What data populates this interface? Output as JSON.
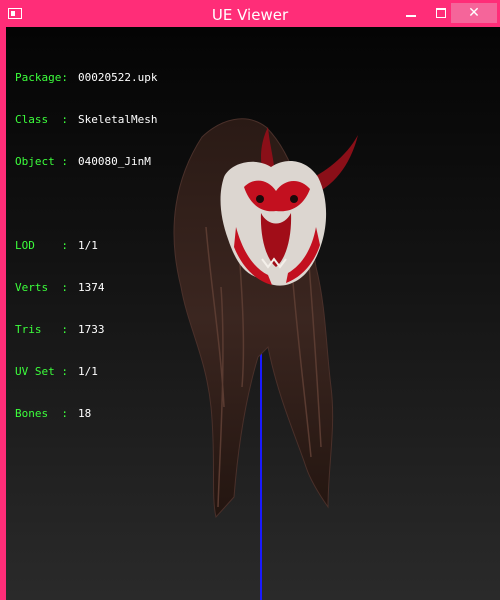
{
  "window": {
    "title": "UE Viewer",
    "close_glyph": "✕"
  },
  "info": {
    "package": {
      "label": "Package:",
      "value": "00020522.upk"
    },
    "class": {
      "label": "Class  :",
      "value": "SkeletalMesh"
    },
    "object": {
      "label": "Object :",
      "value": "040080_JinM"
    },
    "lod": {
      "label": "LOD    :",
      "value": "1/1"
    },
    "verts": {
      "label": "Verts  :",
      "value": "1374"
    },
    "tris": {
      "label": "Tris   :",
      "value": "1733"
    },
    "uvset": {
      "label": "UV Set :",
      "value": "1/1"
    },
    "bones": {
      "label": "Bones  :",
      "value": "18"
    }
  },
  "colors": {
    "accent": "#ff2d78",
    "label": "#3cff3c",
    "axis": "#1a1aff"
  }
}
